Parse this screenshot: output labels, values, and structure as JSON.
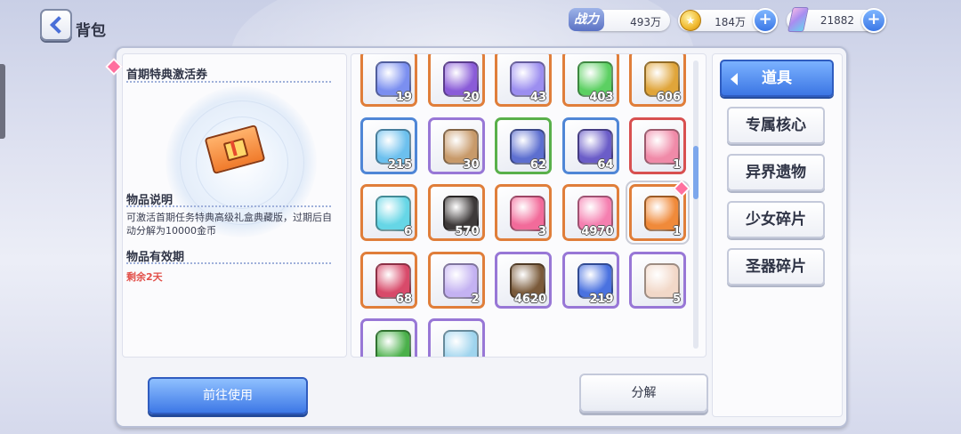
{
  "header": {
    "title": "背包",
    "power_label": "战力",
    "power_value": "493万",
    "coins_value": "184万",
    "gems_value": "21882"
  },
  "detail": {
    "item_name": "首期特典激活券",
    "desc_title": "物品说明",
    "desc_text": "可激活首期任务特典高级礼盒典藏版，过期后自动分解为10000金币",
    "valid_title": "物品有效期",
    "remain": "剩余2天"
  },
  "items": [
    {
      "icon": "blue-card-icon",
      "count": "19",
      "frame": "orange",
      "color": "#7b8ff0"
    },
    {
      "icon": "purple-crystal-icon",
      "count": "20",
      "frame": "orange",
      "color": "#8a5cd8"
    },
    {
      "icon": "star-ticket-icon",
      "count": "43",
      "frame": "orange",
      "color": "#9c8ef0"
    },
    {
      "icon": "green-potion-icon",
      "count": "403",
      "frame": "orange",
      "color": "#5cd062"
    },
    {
      "icon": "gold-coin-stack-icon",
      "count": "606",
      "frame": "orange",
      "color": "#e0a53a"
    },
    {
      "icon": "blue-candy-icon",
      "count": "215",
      "frame": "blue",
      "color": "#6cc0ee"
    },
    {
      "icon": "chest-icon",
      "count": "30",
      "frame": "purple",
      "color": "#c89a6a"
    },
    {
      "icon": "blue-chip-icon",
      "count": "62",
      "frame": "green",
      "color": "#5d6fd0"
    },
    {
      "icon": "purple-chip-icon",
      "count": "64",
      "frame": "blue",
      "color": "#6b5dc8"
    },
    {
      "icon": "pink-bottle-icon",
      "count": "1",
      "frame": "red",
      "color": "#f08aa8"
    },
    {
      "icon": "cyan-capsule-icon",
      "count": "6",
      "frame": "orange",
      "color": "#66d6e6"
    },
    {
      "icon": "ghost-blob-icon",
      "count": "570",
      "frame": "orange",
      "color": "#3e3a3a"
    },
    {
      "icon": "pink-crystal-icon",
      "count": "3",
      "frame": "orange",
      "color": "#f26b9a"
    },
    {
      "icon": "pink-heart-icon",
      "count": "4970",
      "frame": "orange",
      "color": "#f57fb0"
    },
    {
      "icon": "ticket-icon",
      "count": "1",
      "frame": "orange",
      "color": "#f08a3a",
      "selected": true
    },
    {
      "icon": "scroll-icon",
      "count": "68",
      "frame": "orange",
      "color": "#d84a6a"
    },
    {
      "icon": "crystal-star-icon",
      "count": "2",
      "frame": "orange",
      "color": "#c4b2f2"
    },
    {
      "icon": "trophy-icon",
      "count": "4620",
      "frame": "purple",
      "color": "#7a5a3a"
    },
    {
      "icon": "blue-medal-icon",
      "count": "219",
      "frame": "purple",
      "color": "#4a72e0"
    },
    {
      "icon": "heart-ticket-icon",
      "count": "5",
      "frame": "purple",
      "color": "#f2d8c8"
    },
    {
      "icon": "clover-icon",
      "count": "",
      "frame": "purple",
      "color": "#4ab04a"
    },
    {
      "icon": "ice-shard-icon",
      "count": "",
      "frame": "purple",
      "color": "#9fd4ee"
    }
  ],
  "tabs": [
    {
      "label": "道具",
      "active": true
    },
    {
      "label": "专属核心",
      "active": false
    },
    {
      "label": "异界遗物",
      "active": false
    },
    {
      "label": "少女碎片",
      "active": false
    },
    {
      "label": "圣器碎片",
      "active": false
    }
  ],
  "buttons": {
    "use": "前往使用",
    "decompose": "分解"
  }
}
